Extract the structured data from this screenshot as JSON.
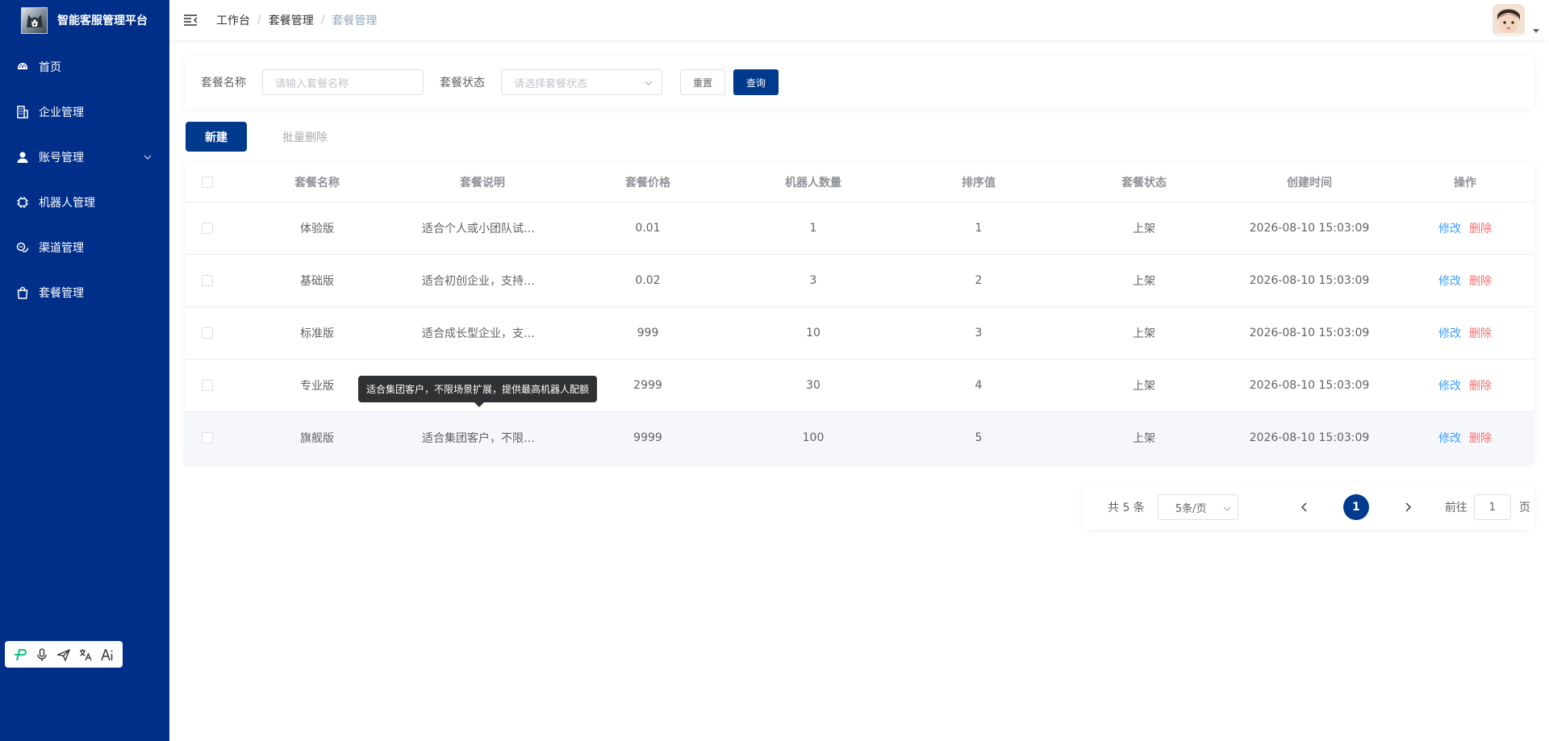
{
  "app": {
    "title": "智能客服管理平台"
  },
  "sidebar": {
    "items": [
      {
        "label": "首页",
        "icon": "dashboard-icon"
      },
      {
        "label": "企业管理",
        "icon": "building-icon"
      },
      {
        "label": "账号管理",
        "icon": "user-icon",
        "expandable": true
      },
      {
        "label": "机器人管理",
        "icon": "chip-icon"
      },
      {
        "label": "渠道管理",
        "icon": "channel-icon"
      },
      {
        "label": "套餐管理",
        "icon": "bag-icon"
      }
    ],
    "tools": [
      "logo-p-icon",
      "microphone-icon",
      "send-icon",
      "translate-icon",
      "ai-icon"
    ]
  },
  "header": {
    "breadcrumb": [
      "工作台",
      "套餐管理",
      "套餐管理"
    ]
  },
  "filter": {
    "name_label": "套餐名称",
    "name_placeholder": "请输入套餐名称",
    "status_label": "套餐状态",
    "status_placeholder": "请选择套餐状态",
    "reset_label": "重置",
    "search_label": "查询"
  },
  "actions": {
    "new_label": "新建",
    "batch_delete_label": "批量删除"
  },
  "table": {
    "columns": [
      "套餐名称",
      "套餐说明",
      "套餐价格",
      "机器人数量",
      "排序值",
      "套餐状态",
      "创建时间",
      "操作"
    ],
    "rows": [
      {
        "name": "体验版",
        "desc": "适合个人或小团队试用，含…",
        "price": "0.01",
        "robots": "1",
        "sort": "1",
        "status": "上架",
        "created": "2026-08-10 15:03:09"
      },
      {
        "name": "基础版",
        "desc": "适合初创企业，支持售前/…",
        "price": "0.02",
        "robots": "3",
        "sort": "2",
        "status": "上架",
        "created": "2026-08-10 15:03:09"
      },
      {
        "name": "标准版",
        "desc": "适合成长型企业，支持多业…",
        "price": "999",
        "robots": "10",
        "sort": "3",
        "status": "上架",
        "created": "2026-08-10 15:03:09"
      },
      {
        "name": "专业版",
        "desc": "",
        "price": "2999",
        "robots": "30",
        "sort": "4",
        "status": "上架",
        "created": "2026-08-10 15:03:09"
      },
      {
        "name": "旗舰版",
        "desc": "适合集团客户，不限场景扩…",
        "price": "9999",
        "robots": "100",
        "sort": "5",
        "status": "上架",
        "created": "2026-08-10 15:03:09"
      }
    ],
    "edit_label": "修改",
    "delete_label": "删除"
  },
  "tooltip": {
    "text": "适合集团客户，不限场景扩展，提供最高机器人配额"
  },
  "pagination": {
    "total": "共 5 条",
    "page_size": "5条/页",
    "current_page": "1",
    "goto_label": "前往",
    "goto_value": "1",
    "page_unit": "页"
  },
  "colors": {
    "sidebar_bg": "#002f8a",
    "primary": "#003a8c",
    "link": "#409eff",
    "danger": "#f56c6c"
  }
}
